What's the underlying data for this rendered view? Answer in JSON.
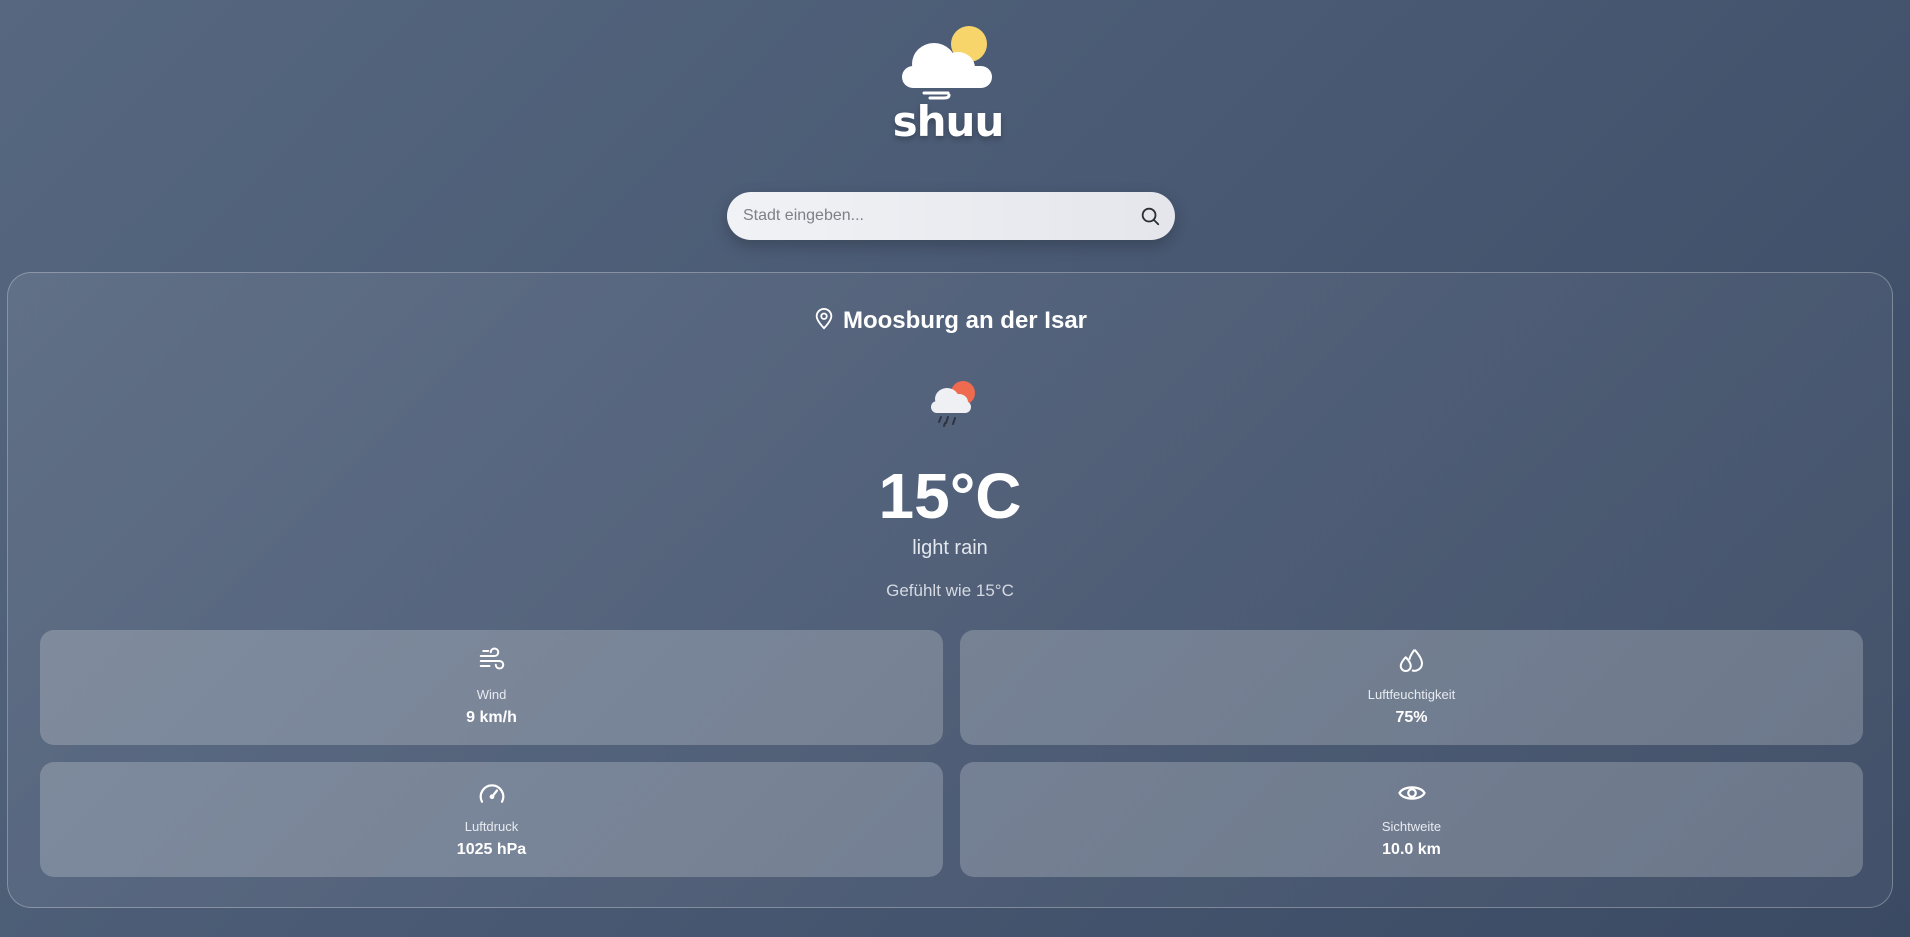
{
  "app": {
    "name": "shuu"
  },
  "search": {
    "placeholder": "Stadt eingeben...",
    "value": "",
    "icon": "search-icon"
  },
  "weather": {
    "location": "Moosburg an der Isar",
    "location_icon": "map-pin-icon",
    "condition_icon": "rain-cloud-sun-icon",
    "temperature": "15°C",
    "description": "light rain",
    "feels_like": "Gefühlt wie 15°C"
  },
  "details": [
    {
      "icon": "wind-icon",
      "label": "Wind",
      "value": "9 km/h"
    },
    {
      "icon": "humidity-droplets-icon",
      "label": "Luftfeuchtigkeit",
      "value": "75%"
    },
    {
      "icon": "pressure-gauge-icon",
      "label": "Luftdruck",
      "value": "1025 hPa"
    },
    {
      "icon": "eye-icon",
      "label": "Sichtweite",
      "value": "10.0 km"
    }
  ],
  "colors": {
    "background_start": "#56677f",
    "background_end": "#3b4a63",
    "sun": "#f7d56b",
    "sun_small": "#ef6b4f"
  }
}
